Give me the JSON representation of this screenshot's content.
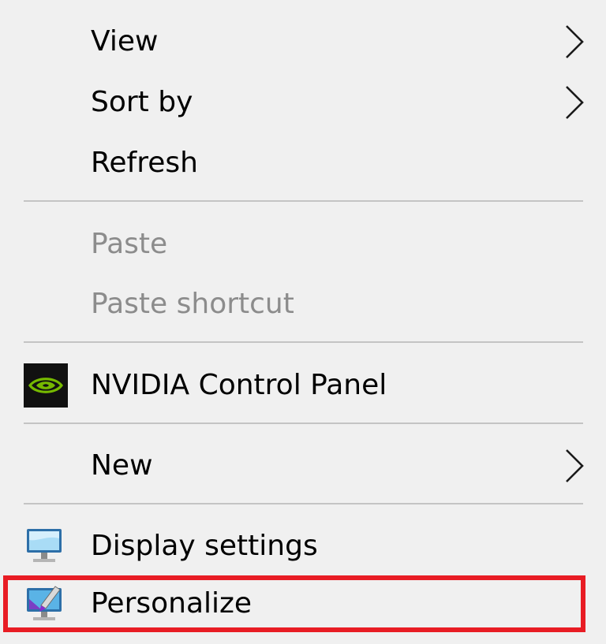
{
  "context_menu": {
    "items": [
      {
        "label": "View",
        "submenu": true,
        "enabled": true
      },
      {
        "label": "Sort by",
        "submenu": true,
        "enabled": true
      },
      {
        "label": "Refresh",
        "submenu": false,
        "enabled": true
      },
      {
        "label": "Paste",
        "submenu": false,
        "enabled": false
      },
      {
        "label": "Paste shortcut",
        "submenu": false,
        "enabled": false
      },
      {
        "label": "NVIDIA Control Panel",
        "submenu": false,
        "enabled": true,
        "icon": "nvidia-icon"
      },
      {
        "label": "New",
        "submenu": true,
        "enabled": true
      },
      {
        "label": "Display settings",
        "submenu": false,
        "enabled": true,
        "icon": "display-settings-icon"
      },
      {
        "label": "Personalize",
        "submenu": false,
        "enabled": true,
        "icon": "personalize-icon",
        "highlighted": true
      }
    ]
  },
  "colors": {
    "menu_background": "#f0f0f0",
    "text": "#000000",
    "disabled_text": "#8c8c8c",
    "separator": "#c4c4c4",
    "highlight_border": "#e81c24",
    "nvidia_green": "#76b900"
  }
}
